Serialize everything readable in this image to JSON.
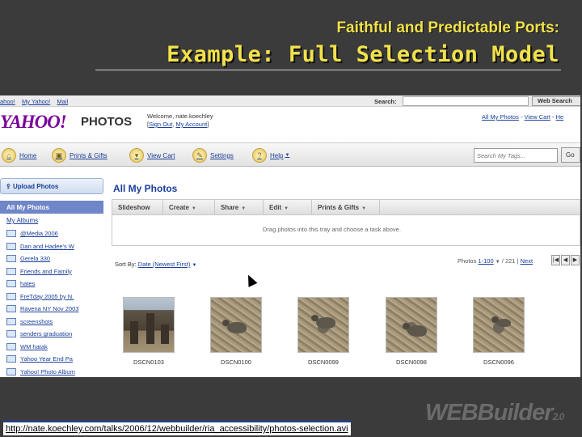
{
  "slide": {
    "supertitle": "Faithful and Predictable Ports:",
    "title": "Example: Full Selection Model",
    "url": "http://nate.koechley.com/talks/2006/12/webbuilder/ria_accessibility/photos-selection.avi",
    "logo_text": "WEBBuilder",
    "logo_version": "2.0"
  },
  "topbar": {
    "links": [
      "ahoo!",
      "My Yahoo!",
      "Mail"
    ],
    "search_label": "Search:",
    "search_button": "Web Search"
  },
  "header": {
    "logo": "YAHOO!",
    "product": "PHOTOS",
    "welcome": "Welcome, nate.koechley",
    "sign_out": "Sign Out",
    "my_account": "My Account",
    "links": [
      "All My Photos",
      "View Cart",
      "He"
    ]
  },
  "nav": {
    "items": [
      {
        "label": "Home",
        "icon": "home-icon"
      },
      {
        "label": "Prints & Gifts",
        "icon": "gift-icon"
      },
      {
        "label": "View Cart",
        "icon": "cart-icon"
      },
      {
        "label": "Settings",
        "icon": "wrench-icon"
      },
      {
        "label": "Help",
        "icon": "help-icon"
      }
    ],
    "tag_search_placeholder": "Search My Tags...",
    "go": "Go"
  },
  "sidebar": {
    "upload": "Upload Photos",
    "all_photos": "All My Photos",
    "albums_label": "My Albums",
    "albums": [
      "@Media 2006",
      "Dan and Hadee's W",
      "Gerela 330",
      "Friends and Family",
      "hates",
      "FreTday 2005 by N.",
      "Ravena NY Nov 2003",
      "screenshots",
      "senders graduation",
      "WM hatak",
      "Yahoo Year End Pa",
      "Yahoo! Photo Album"
    ]
  },
  "main": {
    "title": "All My Photos",
    "tabs": [
      "Slideshow",
      "Create",
      "Share",
      "Edit",
      "Prints & Gifts"
    ],
    "tray_hint": "Drag photos into this tray and choose a task above.",
    "sort_label": "Sort By:",
    "sort_value": "Date (Newest First)",
    "pager_prefix": "Photos",
    "pager_range": "1-100",
    "pager_total": "/ 221",
    "pager_sep": "|",
    "pager_next": "Next",
    "photos": [
      {
        "caption": "DSCN0103",
        "kind": "temple"
      },
      {
        "caption": "DSCN0100",
        "kind": "animal"
      },
      {
        "caption": "DSCN0099",
        "kind": "animal"
      },
      {
        "caption": "DSCN0098",
        "kind": "animal"
      },
      {
        "caption": "DSCN0096",
        "kind": "animal"
      }
    ]
  }
}
